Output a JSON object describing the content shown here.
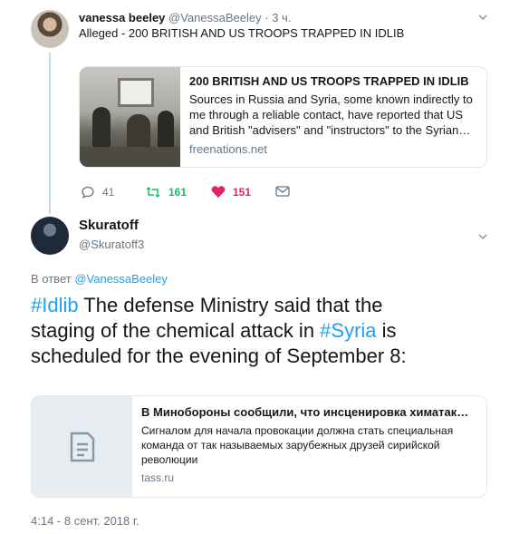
{
  "parent_tweet": {
    "name": "vanessa beeley",
    "handle": "@VanessaBeeley",
    "separator": "·",
    "time": "3 ч.",
    "text": "Alleged - 200 BRITISH AND US TROOPS TRAPPED IN IDLIB",
    "card": {
      "title": "200 BRITISH AND US TROOPS TRAPPED IN IDLIB",
      "description_lines": [
        "Sources in Russia and Syria, some known indirectly to",
        "me through a reliable contact, have reported that US",
        "and British \"advisers\" and \"instructors\" to the Syrian…"
      ],
      "domain": "freenations.net"
    },
    "actions": {
      "reply_count": "41",
      "retweet_count": "161",
      "like_count": "151"
    }
  },
  "main_tweet": {
    "name": "Skuratoff",
    "handle": "@Skuratoff3",
    "reply_prefix": "В ответ",
    "reply_to": "@VanessaBeeley",
    "text_lines": [
      {
        "hashtag": "#Idlib",
        "text": " The defense Ministry said that the"
      },
      {
        "text": "staging of the chemical attack in ",
        "hashtag": "#Syria",
        "tail": " is"
      },
      {
        "text": "scheduled for the evening of September 8:"
      }
    ],
    "card": {
      "title": "В Минобороны сообщили, что инсценировка химатак…",
      "description_lines": [
        "Сигналом для начала провокации должна стать специальная",
        "команда от так называемых зарубежных друзей сирийской",
        "революции"
      ],
      "domain": "tass.ru",
      "icon": "document-icon"
    },
    "timestamp": "4:14 - 8 сент. 2018 г."
  },
  "colors": {
    "link": "#1da1f2",
    "retweet": "#17bf63",
    "like": "#e0245e",
    "muted": "#657786",
    "border": "#e1e8ed"
  }
}
